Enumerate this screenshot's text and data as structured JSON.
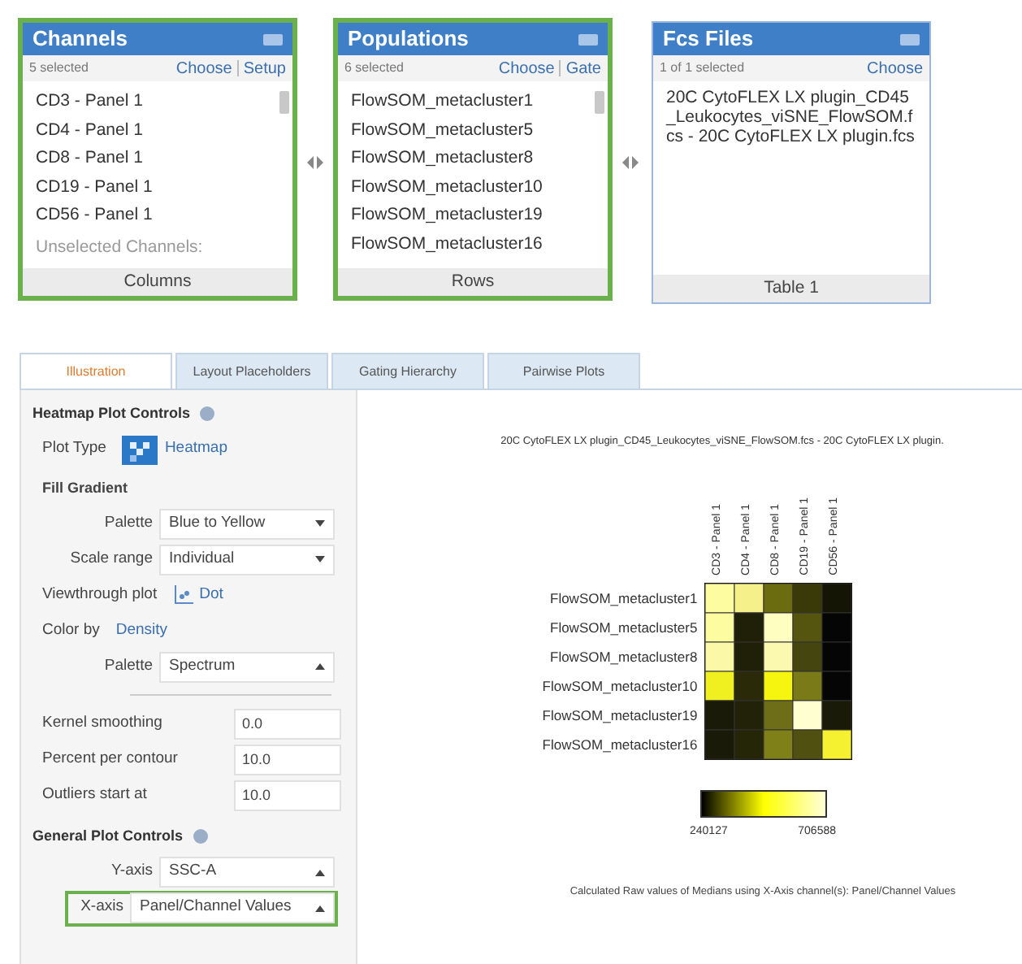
{
  "panels": [
    {
      "title": "Channels",
      "count": "5 selected",
      "links": [
        "Choose",
        "Setup"
      ],
      "items": [
        "CD3 - Panel 1",
        "CD4 - Panel 1",
        "CD8 - Panel 1",
        "CD19 - Panel 1",
        "CD56 - Panel 1"
      ],
      "section": "Unselected Channels:",
      "footer": "Columns",
      "highlighted": true,
      "scroll": true,
      "kind": "list"
    },
    {
      "title": "Populations",
      "count": "6 selected",
      "links": [
        "Choose",
        "Gate"
      ],
      "items": [
        "FlowSOM_metacluster1",
        "FlowSOM_metacluster5",
        "FlowSOM_metacluster8",
        "FlowSOM_metacluster10",
        "FlowSOM_metacluster19",
        "FlowSOM_metacluster16"
      ],
      "footer": "Rows",
      "highlighted": true,
      "scroll": true,
      "kind": "list"
    },
    {
      "title": "Fcs Files",
      "count": "1 of 1 selected",
      "links": [
        "Choose"
      ],
      "items": [
        "20C CytoFLEX LX plugin_CD45_Leukocytes_viSNE_FlowSOM.fcs - 20C CytoFLEX LX plugin.fcs"
      ],
      "footer": "Table 1",
      "highlighted": false,
      "scroll": false,
      "kind": "file"
    }
  ],
  "tabs": [
    {
      "label": "Illustration",
      "selected": true
    },
    {
      "label": "Layout Placeholders",
      "selected": false
    },
    {
      "label": "Gating Hierarchy",
      "selected": false
    },
    {
      "label": "Pairwise Plots",
      "selected": false
    }
  ],
  "controls": [
    {
      "kind": "heading",
      "label": "Heatmap Plot Controls"
    },
    {
      "kind": "plot-type",
      "label": "Plot Type",
      "value": "Heatmap"
    },
    {
      "kind": "subheading",
      "label": "Fill Gradient"
    },
    {
      "kind": "select",
      "label": "Palette",
      "value": "Blue to Yellow",
      "expanded": false
    },
    {
      "kind": "select",
      "label": "Scale range",
      "value": "Individual",
      "expanded": false
    },
    {
      "kind": "viewthrough",
      "label": "Viewthrough plot",
      "value": "Dot"
    },
    {
      "kind": "link",
      "label": "Color by",
      "value": "Density"
    },
    {
      "kind": "select",
      "label": "Palette",
      "value": "Spectrum",
      "expanded": true
    },
    {
      "kind": "divider"
    },
    {
      "kind": "number",
      "label": "Kernel smoothing",
      "value": "0.0"
    },
    {
      "kind": "number",
      "label": "Percent per contour",
      "value": "10.0"
    },
    {
      "kind": "number",
      "label": "Outliers start at",
      "value": "10.0"
    },
    {
      "kind": "heading",
      "label": "General Plot Controls"
    },
    {
      "kind": "select",
      "label": "Y-axis",
      "value": "SSC-A",
      "expanded": true
    },
    {
      "kind": "select",
      "label": "X-axis",
      "value": "Panel/Channel Values",
      "expanded": true,
      "highlighted": true
    }
  ],
  "heatmap": {
    "title": "20C CytoFLEX LX plugin_CD45_Leukocytes_viSNE_FlowSOM.fcs - 20C CytoFLEX LX plugin.",
    "columns": [
      "CD3 - Panel 1",
      "CD4 - Panel 1",
      "CD8 - Panel 1",
      "CD19 - Panel 1",
      "CD56 - Panel 1"
    ],
    "rows": [
      {
        "label": "FlowSOM_metacluster1",
        "cells": [
          {
            "color": "#fdfca0"
          },
          {
            "color": "#f5f08a"
          },
          {
            "color": "#6b6b10"
          },
          {
            "color": "#3a3a08"
          },
          {
            "color": "#151505"
          }
        ]
      },
      {
        "label": "FlowSOM_metacluster5",
        "cells": [
          {
            "color": "#fdfca0"
          },
          {
            "color": "#202008"
          },
          {
            "color": "#fefec0"
          },
          {
            "color": "#555510"
          },
          {
            "color": "#050505"
          }
        ]
      },
      {
        "label": "FlowSOM_metacluster8",
        "cells": [
          {
            "color": "#fbf8a8"
          },
          {
            "color": "#202008"
          },
          {
            "color": "#fbf8b0"
          },
          {
            "color": "#454510"
          },
          {
            "color": "#050505"
          }
        ]
      },
      {
        "label": "FlowSOM_metacluster10",
        "cells": [
          {
            "color": "#f0f020"
          },
          {
            "color": "#2a2a08"
          },
          {
            "color": "#f5f510"
          },
          {
            "color": "#7a7a18"
          },
          {
            "color": "#050505"
          }
        ]
      },
      {
        "label": "FlowSOM_metacluster19",
        "cells": [
          {
            "color": "#1a1a08"
          },
          {
            "color": "#222208"
          },
          {
            "color": "#6e6e18"
          },
          {
            "color": "#fefed0"
          },
          {
            "color": "#1a1a08"
          }
        ]
      },
      {
        "label": "FlowSOM_metacluster16",
        "cells": [
          {
            "color": "#1a1a08"
          },
          {
            "color": "#252508"
          },
          {
            "color": "#808018"
          },
          {
            "color": "#505010"
          },
          {
            "color": "#f5f030"
          }
        ]
      }
    ],
    "legend_min": "240127",
    "legend_max": "706588",
    "caption": "Calculated Raw values of Medians using X-Axis channel(s): Panel/Channel Values"
  }
}
